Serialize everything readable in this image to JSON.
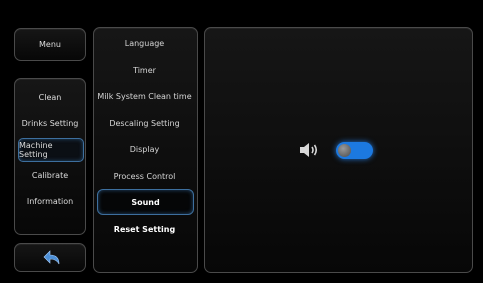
{
  "menu": {
    "label": "Menu"
  },
  "left_menu": {
    "items": [
      {
        "label": "Clean"
      },
      {
        "label": "Drinks Setting"
      },
      {
        "label": "Machine Setting",
        "selected": true
      },
      {
        "label": "Calibrate"
      },
      {
        "label": "Information"
      }
    ]
  },
  "back": {
    "icon": "back-arrow-icon"
  },
  "settings_menu": {
    "items": [
      {
        "label": "Language"
      },
      {
        "label": "Timer"
      },
      {
        "label": "Milk System Clean time"
      },
      {
        "label": "Descaling Setting"
      },
      {
        "label": "Display"
      },
      {
        "label": "Process Control"
      },
      {
        "label": "Sound",
        "selected": true
      },
      {
        "label": "Reset Setting"
      }
    ]
  },
  "sound_panel": {
    "speaker_icon": "speaker-icon",
    "toggle_on": true
  },
  "colors": {
    "accent": "#1c79e0",
    "selection_border": "#3d6f9e",
    "background": "#000000"
  }
}
